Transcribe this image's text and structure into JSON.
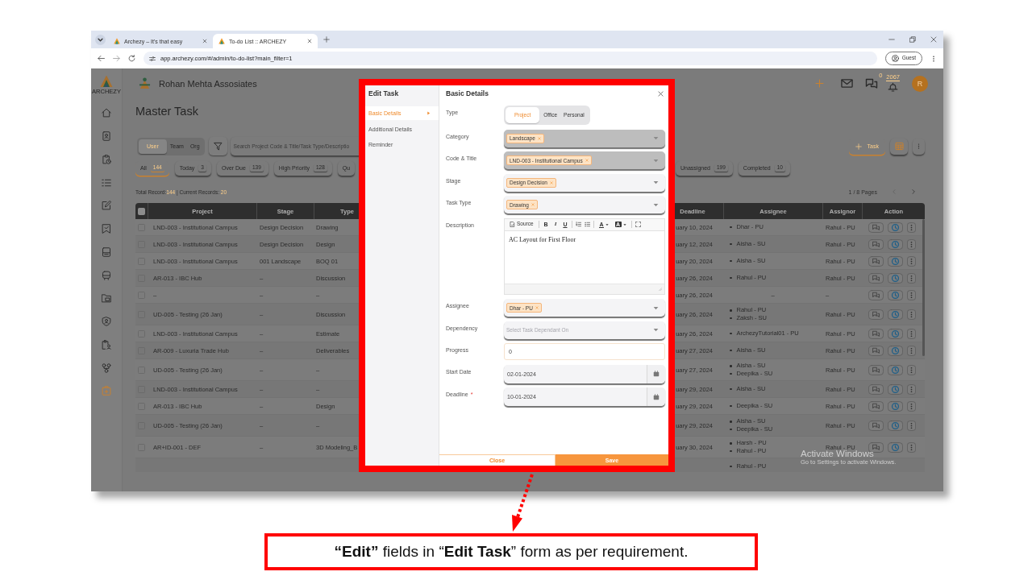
{
  "browser": {
    "tabs": [
      {
        "title": "Archezy – It's that easy",
        "selected": false
      },
      {
        "title": "To-do List :: ARCHEZY",
        "selected": true
      }
    ],
    "url": "app.archezy.com/#/admin/to-do-list?main_filter=1",
    "profile": "Guest"
  },
  "sidebar": {
    "logo_text": "ARCHEZY",
    "items": [
      {
        "selected": false
      },
      {
        "selected": false
      },
      {
        "selected": false
      },
      {
        "selected": false
      },
      {
        "selected": false
      },
      {
        "selected": false
      },
      {
        "selected": false
      },
      {
        "selected": false
      },
      {
        "selected": false
      },
      {
        "selected": false
      },
      {
        "selected": false
      },
      {
        "selected": false
      },
      {
        "selected": true
      }
    ]
  },
  "header": {
    "company": "Rohan Mehta Assosiates",
    "chat_count": "0",
    "notification_count": "2067",
    "avatar": "R"
  },
  "page": {
    "title": "Master Task",
    "scopes": [
      {
        "label": "User",
        "selected": true
      },
      {
        "label": "Team",
        "selected": false
      },
      {
        "label": "Org",
        "selected": false
      }
    ],
    "search": {
      "placeholder": "Search Project Code & Title/Task Type/Descriptio"
    },
    "add_button": "Task",
    "filters_left": [
      {
        "label": "All",
        "count": "144",
        "selected": true
      },
      {
        "label": "Today",
        "count": "3",
        "selected": false
      },
      {
        "label": "Over Due",
        "count": "139",
        "selected": false
      },
      {
        "label": "High Priority",
        "count": "128",
        "selected": false
      },
      {
        "label": "Qu",
        "selected": false
      }
    ],
    "filters_right": [
      {
        "label": "Unassigned",
        "count": "199",
        "selected": false
      },
      {
        "label": "Completed",
        "count": "10",
        "selected": false
      }
    ],
    "records": {
      "total_label": "Total Record:",
      "total": "144",
      "current_label": "| Current Records:",
      "current": "20"
    },
    "pagination": "1 / 8 Pages"
  },
  "table": {
    "checked": false,
    "columns": [
      "Project",
      "Stage",
      "Type",
      "Deadline",
      "Assignee",
      "Assignor",
      "Action"
    ],
    "rows": [
      {
        "checked": false,
        "project": "LND-003 - Institutional Campus",
        "stage": "Design Decision",
        "type": "Drawing",
        "deadline": "uary 10, 2024",
        "assignees": [
          "Dhar - PU"
        ],
        "assignor": "Rahul - PU"
      },
      {
        "checked": false,
        "project": "LND-003 - Institutional Campus",
        "stage": "Design Decision",
        "type": "Design",
        "deadline": "uary 12, 2024",
        "assignees": [
          "Aisha - SU"
        ],
        "assignor": "Rahul - PU"
      },
      {
        "checked": false,
        "project": "LND-003 - Institutional Campus",
        "stage": "001 Landscape",
        "type": "BOQ 01",
        "deadline": "uary 20, 2024",
        "assignees": [
          "Aisha - SU"
        ],
        "assignor": "Rahul - PU"
      },
      {
        "checked": false,
        "project": "AR-013 - IBC Hub",
        "stage": "–",
        "type": "Discussion",
        "deadline": "uary 26, 2024",
        "assignees": [
          "Rahul - PU"
        ],
        "assignor": "Rahul - PU"
      },
      {
        "checked": false,
        "project": "–",
        "stage": "–",
        "type": "–",
        "deadline": "uary 26, 2024",
        "assignee": "–",
        "assignor": "–"
      },
      {
        "checked": false,
        "project": "UD-005 - Testing (26 Jan)",
        "stage": "–",
        "type": "Discussion",
        "deadline": "uary 26, 2024",
        "assignees": [
          "Rahul - PU",
          "Zaksh - SU"
        ],
        "assignor": "Rahul - PU"
      },
      {
        "checked": false,
        "project": "LND-003 - Institutional Campus",
        "stage": "–",
        "type": "Estimate",
        "deadline": "uary 26, 2024",
        "assignees": [
          "ArchezyTutorial01 - PU"
        ],
        "assignor": "Rahul - PU"
      },
      {
        "checked": false,
        "project": "AR-009 - Luxuria Trade Hub",
        "stage": "–",
        "type": "Deliverables",
        "deadline": "uary 27, 2024",
        "assignees": [
          "Aisha - SU"
        ],
        "assignor": "Rahul - PU"
      },
      {
        "checked": false,
        "project": "UD-005 - Testing (26 Jan)",
        "stage": "–",
        "type": "–",
        "deadline": "uary 27, 2024",
        "assignees": [
          "Aisha - SU",
          "Deepika - SU"
        ],
        "assignor": "Rahul - PU"
      },
      {
        "checked": false,
        "project": "LND-003 - Institutional Campus",
        "stage": "–",
        "type": "–",
        "deadline": "uary 29, 2024",
        "assignees": [
          "Aisha - SU"
        ],
        "assignor": "Rahul - PU"
      },
      {
        "checked": false,
        "project": "AR-013 - IBC Hub",
        "stage": "–",
        "type": "Design",
        "deadline": "uary 29, 2024",
        "assignees": [
          "Deepika - SU"
        ],
        "assignor": "Rahul - PU"
      },
      {
        "checked": false,
        "project": "UD-005 - Testing (26 Jan)",
        "stage": "–",
        "type": "–",
        "deadline": "uary 29, 2024",
        "assignees": [
          "Aisha - SU",
          "Deepika - SU"
        ],
        "assignor": "Rahul - PU"
      },
      {
        "checked": false,
        "project": "AR+ID-001 - DEF",
        "stage": "–",
        "type": "3D Modeling_B",
        "deadline": "uary 30, 2024",
        "assignees": [
          "Harsh - PU",
          "Rahul - PU"
        ],
        "assignor": "Rahul - PU"
      },
      {
        "assignees": [
          "Rahul - PU"
        ]
      }
    ]
  },
  "dialog": {
    "title": "Edit Task",
    "nav": [
      {
        "label": "Basic Details",
        "selected": true
      },
      {
        "label": "Additional Details",
        "selected": false
      },
      {
        "label": "Reminder",
        "selected": false
      }
    ],
    "heading": "Basic Details",
    "fields": [
      {
        "kind": "segmented",
        "label": "Type",
        "options": [
          {
            "label": "Project",
            "selected": true
          },
          {
            "label": "Office",
            "selected": false
          },
          {
            "label": "Personal",
            "selected": false
          }
        ]
      },
      {
        "kind": "select",
        "label": "Category",
        "chips": [
          "Landscape"
        ],
        "disabled": true
      },
      {
        "kind": "select",
        "label": "Code & Title",
        "chips": [
          "LND-003 - Institutional Campus"
        ],
        "disabled": true
      },
      {
        "kind": "select",
        "label": "Stage",
        "chips": [
          "Design Decision"
        ],
        "disabled": false
      },
      {
        "kind": "select",
        "label": "Task Type",
        "chips": [
          "Drawing"
        ],
        "disabled": false
      },
      {
        "kind": "editor",
        "label": "Description",
        "toolbar": [
          {
            "items": [
              {
                "kind": "source",
                "label": "Source"
              }
            ]
          },
          {
            "items": [
              {
                "kind": "bold",
                "label": "B"
              },
              {
                "kind": "italic",
                "label": "I"
              },
              {
                "kind": "underline",
                "label": "U"
              }
            ]
          },
          {
            "items": [
              {
                "kind": "numbered-list"
              },
              {
                "kind": "bulleted-list"
              }
            ]
          },
          {
            "items": [
              {
                "kind": "text-color",
                "label": "A"
              },
              {
                "kind": "background-color",
                "label": "A"
              }
            ]
          },
          {
            "items": [
              {
                "kind": "maximize"
              }
            ]
          }
        ],
        "value": "AC Layout for First Floor"
      },
      {
        "kind": "select",
        "label": "Assignee",
        "chips": [
          "Dhar - PU"
        ],
        "disabled": false
      },
      {
        "kind": "select",
        "label": "Dependency",
        "placeholder": "Select Task Dependant On",
        "disabled": false
      },
      {
        "kind": "text",
        "label": "Progress",
        "value": "0"
      },
      {
        "kind": "date",
        "label": "Start Date",
        "value": "02-01-2024"
      },
      {
        "kind": "date",
        "label": "Deadline",
        "required_mark": "*",
        "value": "10-01-2024"
      }
    ],
    "buttons": [
      {
        "label": "Close",
        "kind": "secondary"
      },
      {
        "label": "Save",
        "kind": "primary"
      }
    ]
  },
  "os_notice": {
    "title": "Activate Windows",
    "subtitle": "Go to Settings to activate Windows."
  },
  "caption": "**“Edit”** fields in “**Edit Task**” form as per requirement."
}
